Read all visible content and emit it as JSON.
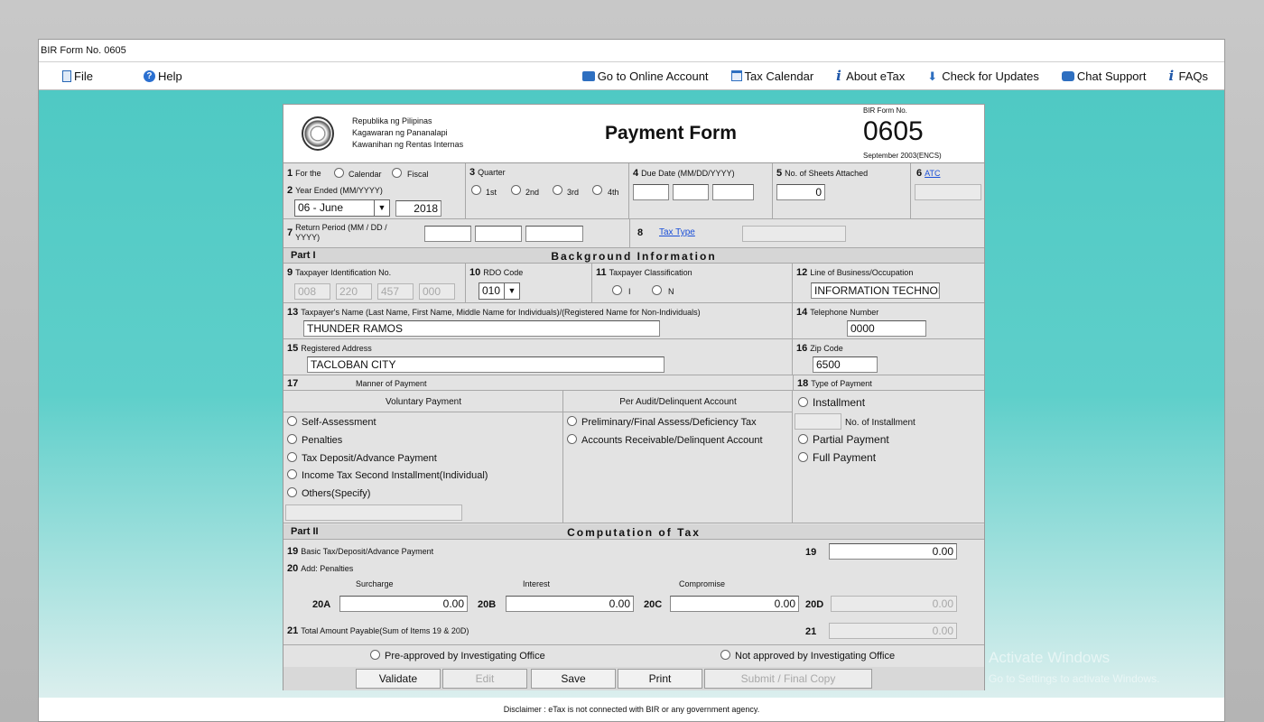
{
  "window": {
    "title": "BIR Form No. 0605"
  },
  "menu": {
    "file": "File",
    "help": "Help",
    "online_account": "Go to Online Account",
    "tax_calendar": "Tax Calendar",
    "about": "About eTax",
    "updates": "Check for Updates",
    "chat": "Chat Support",
    "faqs": "FAQs"
  },
  "header": {
    "agency_line1": "Republika ng Pilipinas",
    "agency_line2": "Kagawaran ng Pananalapi",
    "agency_line3": "Kawanihan ng Rentas Internas",
    "title": "Payment Form",
    "form_no_label": "BIR Form No.",
    "form_no": "0605",
    "form_date": "September 2003(ENCS)"
  },
  "fields": {
    "f1_num": "1",
    "f1_label": "For the",
    "f1_calendar": "Calendar",
    "f1_fiscal": "Fiscal",
    "f2_num": "2",
    "f2_label": "Year Ended (MM/YYYY)",
    "f2_month": "06 - June",
    "f2_year": "2018",
    "f3_num": "3",
    "f3_label": "Quarter",
    "q1": "1st",
    "q2": "2nd",
    "q3": "3rd",
    "q4": "4th",
    "f4_num": "4",
    "f4_label": "Due Date (MM/DD/YYYY)",
    "f5_num": "5",
    "f5_label": "No. of Sheets Attached",
    "f5_value": "0",
    "f6_num": "6",
    "f6_link": "ATC",
    "f7_num": "7",
    "f7_label_1": "Return Period (MM / DD /",
    "f7_label_2": "YYYY)",
    "f8_num": "8",
    "f8_link": "Tax Type"
  },
  "part1": {
    "label": "Part I",
    "title": "Background Information",
    "f9_num": "9",
    "f9_label": "Taxpayer Identification No.",
    "tin": [
      "008",
      "220",
      "457",
      "000"
    ],
    "f10_num": "10",
    "f10_label": "RDO Code",
    "rdo": "010",
    "f11_num": "11",
    "f11_label": "Taxpayer Classification",
    "class_i": "I",
    "class_n": "N",
    "f12_num": "12",
    "f12_label": "Line of Business/Occupation",
    "business": "INFORMATION TECHNOL",
    "f13_num": "13",
    "f13_label": "Taxpayer's Name (Last Name, First Name, Middle Name for Individuals)/(Registered Name for Non-Individuals)",
    "name": "THUNDER RAMOS",
    "f14_num": "14",
    "f14_label": "Telephone Number",
    "phone": "0000",
    "f15_num": "15",
    "f15_label": "Registered Address",
    "address": "TACLOBAN CITY",
    "f16_num": "16",
    "f16_label": "Zip Code",
    "zip": "6500",
    "f17_num": "17",
    "f17_label": "Manner of Payment",
    "f18_num": "18",
    "f18_label": "Type of Payment",
    "voluntary_title": "Voluntary Payment",
    "audit_title": "Per Audit/Delinquent Account",
    "vol_options": [
      "Self-Assessment",
      "Penalties",
      "Tax Deposit/Advance Payment",
      "Income Tax Second Installment(Individual)",
      "Others(Specify)"
    ],
    "audit_options": [
      "Preliminary/Final Assess/Deficiency Tax",
      "Accounts Receivable/Delinquent Account"
    ],
    "type_installment": "Installment",
    "no_installment": "No. of Installment",
    "type_partial": "Partial Payment",
    "type_full": "Full Payment"
  },
  "part2": {
    "label": "Part II",
    "title": "Computation of Tax",
    "f19_num": "19",
    "f19_label": "Basic Tax/Deposit/Advance Payment",
    "f19_value": "0.00",
    "f20_num": "20",
    "f20_label": "Add: Penalties",
    "surcharge_label": "Surcharge",
    "interest_label": "Interest",
    "compromise_label": "Compromise",
    "f20a": "20A",
    "f20a_value": "0.00",
    "f20b": "20B",
    "f20b_value": "0.00",
    "f20c": "20C",
    "f20c_value": "0.00",
    "f20d": "20D",
    "f20d_value": "0.00",
    "f21_num": "21",
    "f21_label": "Total Amount Payable(Sum of Items 19 & 20D)",
    "f21_value": "0.00"
  },
  "approval": {
    "pre_approved": "Pre-approved by Investigating Office",
    "not_approved": "Not approved by Investigating Office"
  },
  "buttons": {
    "validate": "Validate",
    "edit": "Edit",
    "save": "Save",
    "print": "Print",
    "submit": "Submit / Final Copy"
  },
  "footer": {
    "disclaimer": "Disclaimer : eTax is not connected with BIR or any government agency."
  },
  "watermark": {
    "line1": "Activate Windows",
    "line2": "Go to Settings to activate Windows."
  }
}
